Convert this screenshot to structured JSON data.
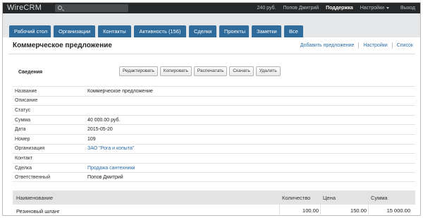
{
  "app": {
    "logo": "WireCRM",
    "balance": "240 руб.",
    "user": "Попов Дмитрий",
    "support": "Поддержка",
    "settings": "Настройки",
    "exit": "Выход"
  },
  "tabs": [
    {
      "label": "Рабочий стол"
    },
    {
      "label": "Организации"
    },
    {
      "label": "Контакты"
    },
    {
      "label": "Активность (156)"
    },
    {
      "label": "Сделки"
    },
    {
      "label": "Проекты"
    },
    {
      "label": "Заметки"
    },
    {
      "label": "Все"
    }
  ],
  "header": {
    "title": "Коммерческое предложение",
    "links": {
      "add": "Добавить предложение",
      "settings": "Настройки",
      "list": "Список"
    }
  },
  "section": {
    "label": "Сведения",
    "actions": {
      "edit": "Редактировать",
      "copy": "Копировать",
      "print": "Распечатать",
      "download": "Скачать",
      "delete": "Удалить"
    }
  },
  "properties": [
    {
      "key": "Название",
      "value": "Коммерческое предложение"
    },
    {
      "key": "Описание",
      "value": ""
    },
    {
      "key": "Статус",
      "value": ""
    },
    {
      "key": "Сумма",
      "value": "40 000.00 руб."
    },
    {
      "key": "Дата",
      "value": "2015-05-20"
    },
    {
      "key": "Номер",
      "value": "109"
    },
    {
      "key": "Организация",
      "value": "ЗАО \"Рога и копыта\""
    },
    {
      "key": "Контакт",
      "value": ""
    },
    {
      "key": "Сделка",
      "value": "Продажа сантехники"
    },
    {
      "key": "Ответственный",
      "value": "Попов Дмитрий"
    }
  ],
  "items_table": {
    "headers": {
      "name": "Наименование",
      "qty": "Количество",
      "price": "Цена",
      "sum": "Сумма"
    },
    "rows": [
      {
        "name": "Резиновый шланг",
        "qty": "100.00",
        "price": "150.00",
        "sum": "15 000.00"
      }
    ]
  },
  "colors": {
    "topbar": "#262829",
    "tab": "#2f6b9b",
    "link": "#2b6da8"
  }
}
